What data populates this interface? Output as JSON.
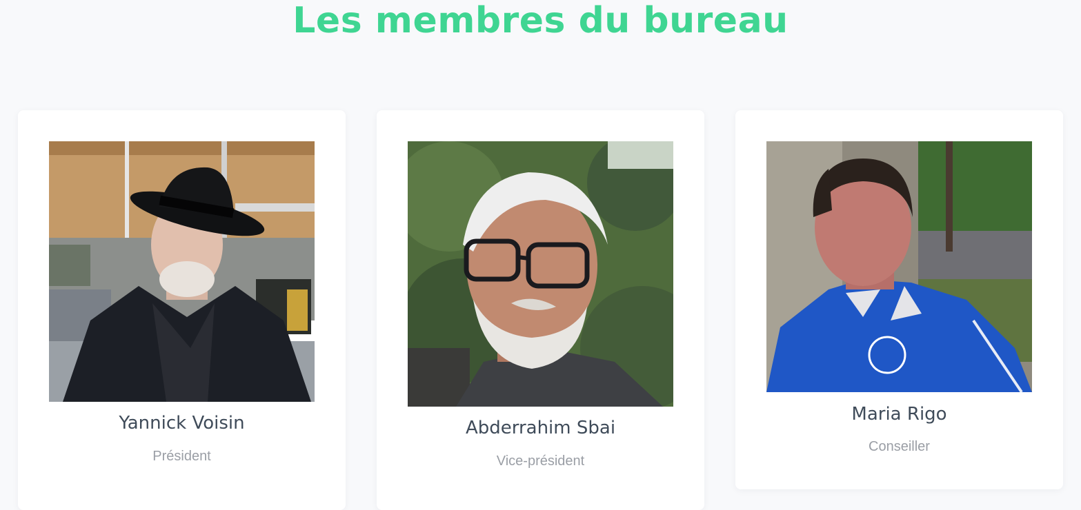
{
  "section": {
    "title": "Les membres du bureau"
  },
  "members": [
    {
      "name": "Yannick Voisin",
      "role": "Président",
      "photo_icon": "portrait-man-black-hat"
    },
    {
      "name": "Abderrahim Sbai",
      "role": "Vice-président",
      "photo_icon": "portrait-man-glasses"
    },
    {
      "name": "Maria Rigo",
      "role": "Conseiller",
      "photo_icon": "portrait-woman-blue-jacket"
    }
  ],
  "colors": {
    "accent": "#3fd592",
    "name_text": "#3f4b59",
    "role_text": "#9a9ea5",
    "background": "#f8f9fb",
    "card": "#ffffff"
  }
}
